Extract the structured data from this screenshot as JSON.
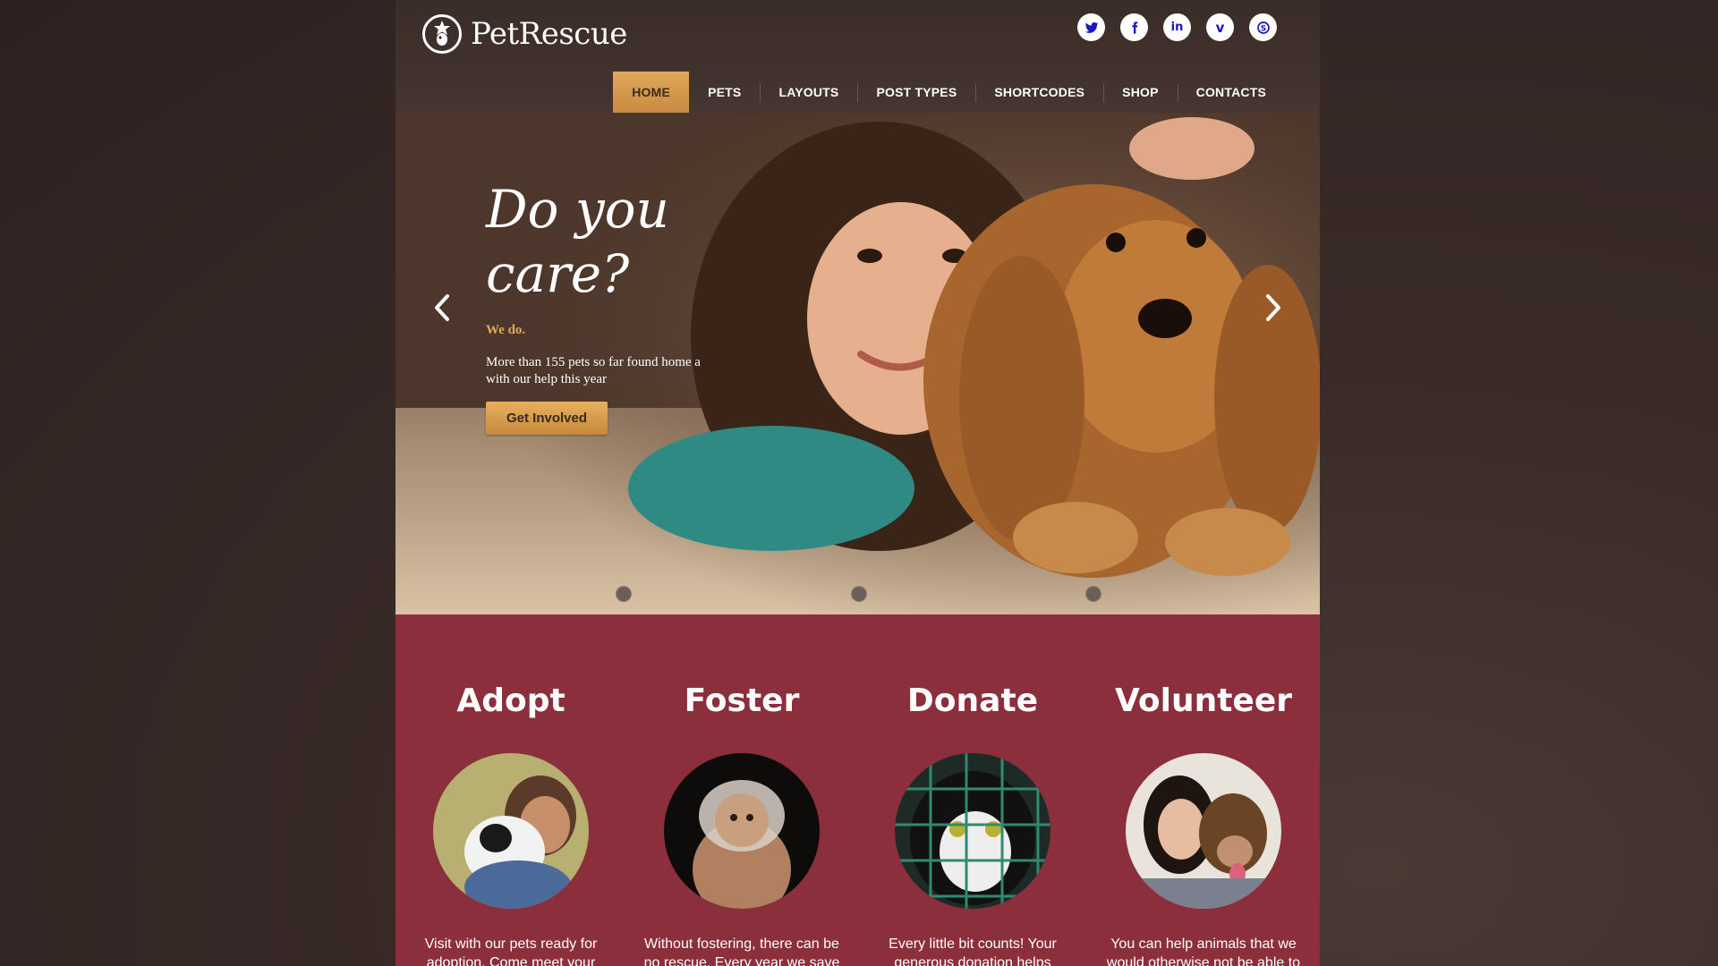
{
  "brand": {
    "name": "PetRescue"
  },
  "socials": [
    {
      "icon": "twitter-icon",
      "glyph": "t"
    },
    {
      "icon": "facebook-icon",
      "glyph": "f"
    },
    {
      "icon": "linkedin-icon",
      "glyph": "in"
    },
    {
      "icon": "vimeo-icon",
      "glyph": "v"
    },
    {
      "icon": "skype-icon",
      "glyph": "S"
    }
  ],
  "nav": {
    "items": [
      "HOME",
      "PETS",
      "LAYOUTS",
      "POST TYPES",
      "SHORTCODES",
      "SHOP",
      "CONTACTS"
    ],
    "active": "HOME"
  },
  "hero": {
    "title": "Do you care?",
    "subtitle": "We do.",
    "description": "More than 155 pets so far found home a with our help this year",
    "button": "Get Involved",
    "slides": 3
  },
  "services": [
    {
      "title": "Adopt",
      "text": "Visit with our pets ready for adoption. Come meet your"
    },
    {
      "title": "Foster",
      "text": "Without fostering, there can be no rescue. Every year we save"
    },
    {
      "title": "Donate",
      "text": "Every little bit counts! Your generous donation helps"
    },
    {
      "title": "Volunteer",
      "text": "You can help animals that we would otherwise not be able to"
    }
  ],
  "colors": {
    "accent": "#e0a85c",
    "services_bg": "#8b2f3c",
    "social_icon": "#1a14c8"
  }
}
